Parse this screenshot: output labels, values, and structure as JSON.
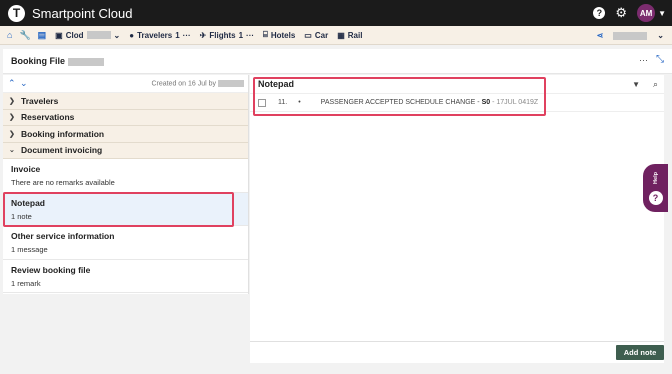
{
  "app": {
    "title": "Smartpoint Cloud",
    "logo_letter": "T"
  },
  "topbar": {
    "help_icon": "?",
    "settings_icon": "gear-icon",
    "user_initials": "AM"
  },
  "nav": {
    "home_icon": "home-icon",
    "tools_icon": "wrench-icon",
    "stack_icon": "stack-icon",
    "booking_label": "Clod",
    "travelers_label": "Travelers",
    "travelers_count": "1",
    "flights_label": "Flights",
    "flights_count": "1",
    "hotels_label": "Hotels",
    "car_label": "Car",
    "rail_label": "Rail",
    "more": "···"
  },
  "booking_file": {
    "title": "Booking File",
    "more": "···"
  },
  "left_panel": {
    "created_text": "Created on 16 Jul by",
    "sections": [
      "Travelers",
      "Reservations",
      "Booking information",
      "Document invoicing"
    ],
    "items": [
      {
        "title": "Invoice",
        "subtitle": "There are no remarks available"
      },
      {
        "title": "Notepad",
        "subtitle": "1 note"
      },
      {
        "title": "Other service information",
        "subtitle": "1 message"
      },
      {
        "title": "Review booking file",
        "subtitle": "1 remark"
      }
    ]
  },
  "notepad": {
    "title": "Notepad",
    "rows": [
      {
        "number": "11.",
        "bullet": "•",
        "text": "PASSENGER ACCEPTED SCHEDULE CHANGE",
        "sep": " - ",
        "code": "S0",
        "sep2": " - ",
        "stamp": "17JUL 0419Z"
      }
    ],
    "add_button": "Add note"
  },
  "help": {
    "label": "Help",
    "icon": "?"
  },
  "colors": {
    "accent": "#2566c4",
    "brand": "#6f2160",
    "highlight": "#e0415f",
    "button": "#3e5e4f"
  }
}
